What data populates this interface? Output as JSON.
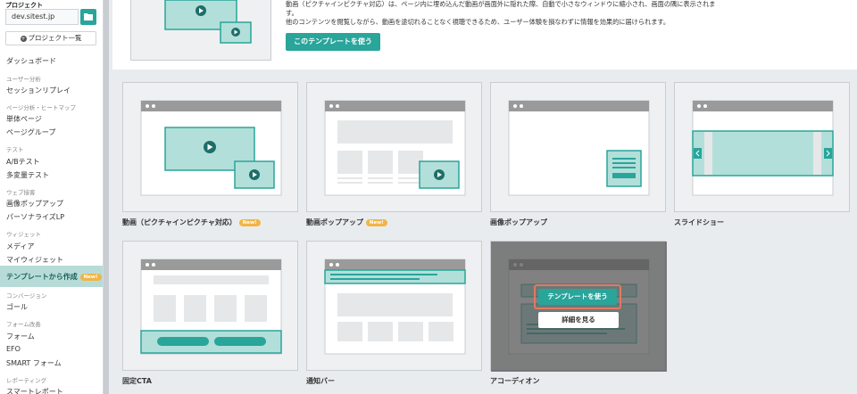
{
  "sidebar": {
    "project_label": "プロジェクト",
    "site": "dev.sitest.jp",
    "projects_button": "プロジェクト一覧",
    "dashboard": "ダッシュボード",
    "sections": {
      "user_analysis": "ユーザー分析",
      "page_analysis": "ページ分析・ヒートマップ",
      "test": "テスト",
      "web_service": "ウェブ接客",
      "widget": "ウィジェット",
      "conversion": "コンバージョン",
      "form": "フォーム改善",
      "reporting": "レポーティング"
    },
    "items": {
      "session_replay": "セッションリプレイ",
      "single_page": "単体ページ",
      "page_group": "ページグループ",
      "ab_test": "A/Bテスト",
      "multivariate": "多変量テスト",
      "image_popup": "画像ポップアップ",
      "personalize_lp": "パーソナライズLP",
      "media": "メディア",
      "my_widget": "マイウィジェット",
      "create_from_template": "テンプレートから作成",
      "goal": "ゴール",
      "form": "フォーム",
      "efo": "EFO",
      "smart_form": "SMART フォーム",
      "smart_report": "スマートレポート"
    },
    "new_badge": "New!"
  },
  "top": {
    "desc_line1": "動画（ピクチャインピクチャ対応）は、ページ内に埋め込んだ動画が画面外に隠れた際、自動で小さなウィンドウに縮小され、画面の隅に表示されま",
    "desc_line2": "す。",
    "desc_line3": "他のコンテンツを閲覧しながら、動画を途切れることなく視聴できるため、ユーザー体験を損なわずに情報を効果的に届けられます。",
    "use_button": "このテンプレートを使う"
  },
  "templates": [
    {
      "label": "動画（ピクチャインピクチャ対応）",
      "badge": "New!"
    },
    {
      "label": "動画ポップアップ",
      "badge": "New!"
    },
    {
      "label": "画像ポップアップ",
      "badge": ""
    },
    {
      "label": "スライドショー",
      "badge": ""
    },
    {
      "label": "固定CTA",
      "badge": ""
    },
    {
      "label": "通知バー",
      "badge": ""
    },
    {
      "label": "アコーディオン",
      "badge": ""
    }
  ],
  "overlay": {
    "use_button": "テンプレートを使う",
    "detail_button": "詳細を見る"
  },
  "colors": {
    "accent": "#29a59a",
    "accent_light": "#b3dfda",
    "badge": "#f1b544",
    "highlight_border": "#e07a62"
  }
}
